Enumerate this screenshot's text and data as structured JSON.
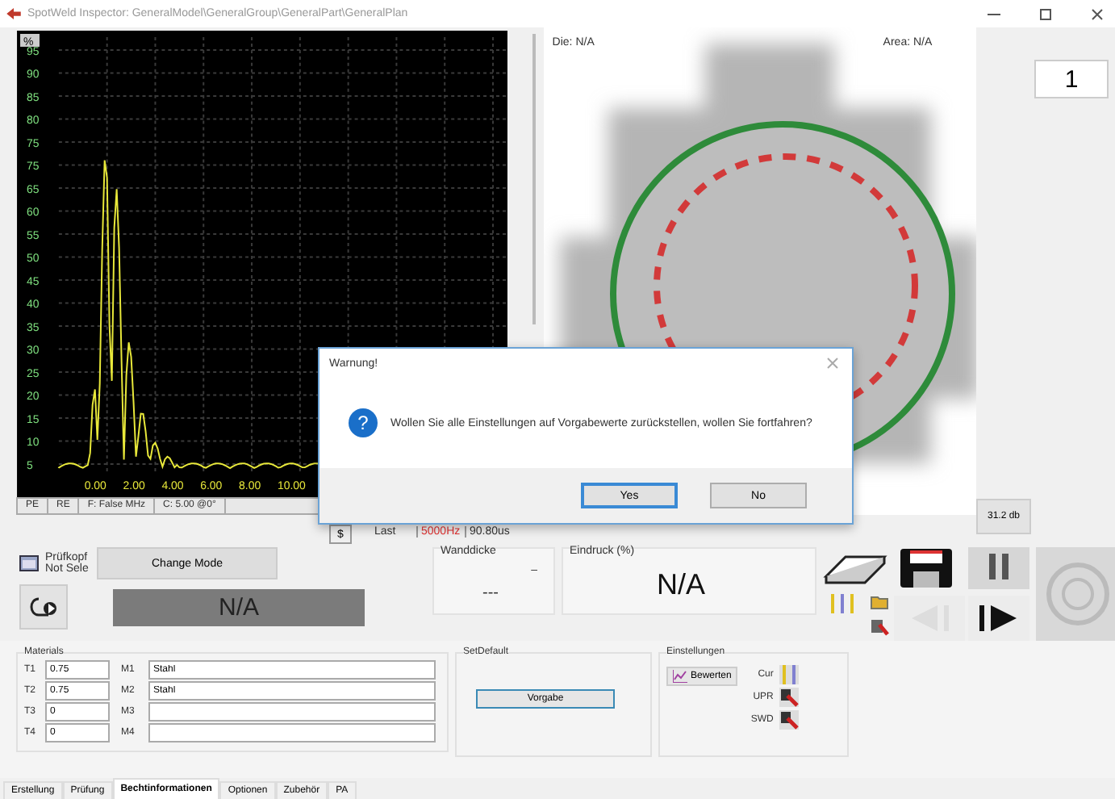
{
  "window": {
    "title": "SpotWeld Inspector: GeneralModel\\GeneralGroup\\GeneralPart\\GeneralPlan"
  },
  "scope": {
    "corner_label": "%",
    "y_labels": [
      "95",
      "90",
      "85",
      "80",
      "75",
      "75",
      "65",
      "60",
      "55",
      "50",
      "45",
      "40",
      "35",
      "30",
      "25",
      "20",
      "15",
      "10",
      "5"
    ],
    "x_labels": [
      "0.00",
      "2.00",
      "4.00",
      "6.00",
      "8.00",
      "10.00"
    ],
    "status": [
      "PE",
      "RE",
      "F: False MHz",
      "C: 5.00 @0°"
    ]
  },
  "view": {
    "die": "Die: N/A",
    "area": "Area: N/A"
  },
  "counter": "1",
  "gain_button": "31.2 db",
  "readout": {
    "step_button": "$",
    "last": "Last",
    "frequency": "5000Hz",
    "time": "90.80us"
  },
  "probe": {
    "label": "Prüfkopf",
    "status": "Not Sele",
    "mode_button": "Change Mode",
    "value": "N/A"
  },
  "wall": {
    "title": "Wanddicke",
    "unit": "–",
    "value": "---"
  },
  "indent": {
    "title": "Eindruck (%)",
    "value": "N/A"
  },
  "transport": {
    "back_disabled": true
  },
  "materials": {
    "title": "Materials",
    "rows": [
      {
        "t_label": "T1",
        "thickness": "0.75",
        "m_label": "M1",
        "material": "Stahl"
      },
      {
        "t_label": "T2",
        "thickness": "0.75",
        "m_label": "M2",
        "material": "Stahl"
      },
      {
        "t_label": "T3",
        "thickness": "0",
        "m_label": "M3"
      },
      {
        "t_label": "T4",
        "thickness": "0",
        "m_label": "M4"
      }
    ]
  },
  "set_default": {
    "title": "SetDefault",
    "button": "Vorgabe"
  },
  "settings": {
    "title": "Einstellungen",
    "button": "Bewerten",
    "items": [
      {
        "label": "Cur",
        "kind": "bars"
      },
      {
        "label": "UPR",
        "kind": "tool"
      },
      {
        "label": "SWD",
        "kind": "tool"
      }
    ]
  },
  "tabs": [
    {
      "label": "Erstellung",
      "selected": false
    },
    {
      "label": "Prüfung",
      "selected": false
    },
    {
      "label": "Bechtinformationen",
      "selected": true
    },
    {
      "label": "Optionen",
      "selected": false
    },
    {
      "label": "Zubehör",
      "selected": false
    },
    {
      "label": "PA",
      "selected": false
    }
  ],
  "dialog": {
    "title": "Warnung!",
    "icon": "?",
    "message": "Wollen Sie alle Einstellungen auf Vorgabewerte zurückstellen, wollen Sie fortfahren?",
    "buttons": [
      {
        "label": "Yes",
        "selected": true
      },
      {
        "label": "No",
        "selected": false
      }
    ]
  }
}
